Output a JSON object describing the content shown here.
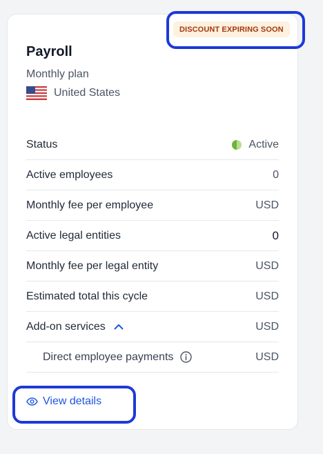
{
  "card": {
    "badge": "DISCOUNT EXPIRING SOON",
    "title": "Payroll",
    "plan": "Monthly plan",
    "country": "United States",
    "flag_icon": "us-flag-icon"
  },
  "rows": [
    {
      "label": "Status",
      "value": "Active",
      "status_color": "#7cc043"
    },
    {
      "label": "Active employees",
      "value": "0"
    },
    {
      "label": "Monthly fee per employee",
      "value": "USD"
    },
    {
      "label": "Active legal entities",
      "value": "0"
    },
    {
      "label": "Monthly fee per legal entity",
      "value": "USD"
    },
    {
      "label": "Estimated total this cycle",
      "value": "USD"
    },
    {
      "label": "Add-on services",
      "value": "USD",
      "toggle_icon": "chevron-up-icon"
    },
    {
      "label": "Direct employee payments",
      "value": "USD",
      "info_icon": "info-icon"
    }
  ],
  "actions": {
    "view_details": "View details",
    "view_icon": "eye-icon"
  },
  "colors": {
    "accent": "#1e55e0",
    "annotation": "#1d3ad6",
    "badge_text": "#a4380f",
    "badge_bg": "#fdf1df"
  }
}
